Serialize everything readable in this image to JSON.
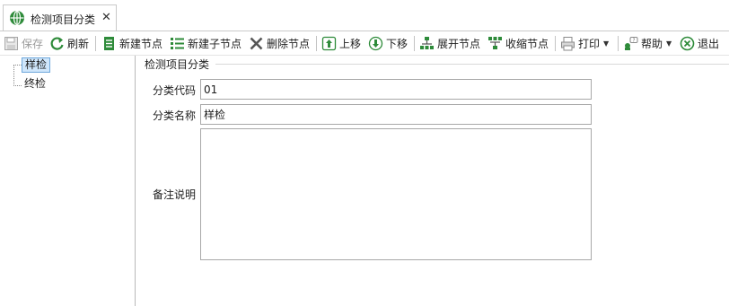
{
  "tab": {
    "title": "检测项目分类",
    "close_glyph": "✕"
  },
  "toolbar": {
    "save": "保存",
    "refresh": "刷新",
    "new_node": "新建节点",
    "new_child_node": "新建子节点",
    "delete_node": "删除节点",
    "move_up": "上移",
    "move_down": "下移",
    "expand_nodes": "展开节点",
    "collapse_nodes": "收缩节点",
    "print": "打印",
    "help": "帮助",
    "exit": "退出"
  },
  "tree": {
    "items": [
      {
        "label": "样检",
        "selected": true
      },
      {
        "label": "终检",
        "selected": false
      }
    ]
  },
  "form": {
    "group_title": "检测项目分类",
    "code_label": "分类代码",
    "code_value": "01",
    "name_label": "分类名称",
    "name_value": "样检",
    "remark_label": "备注说明",
    "remark_value": ""
  },
  "colors": {
    "accent_green": "#2e8b3a",
    "icon_blue": "#2b6cb0",
    "delete_gray": "#555555",
    "selection_bg": "#cfe6fb"
  }
}
